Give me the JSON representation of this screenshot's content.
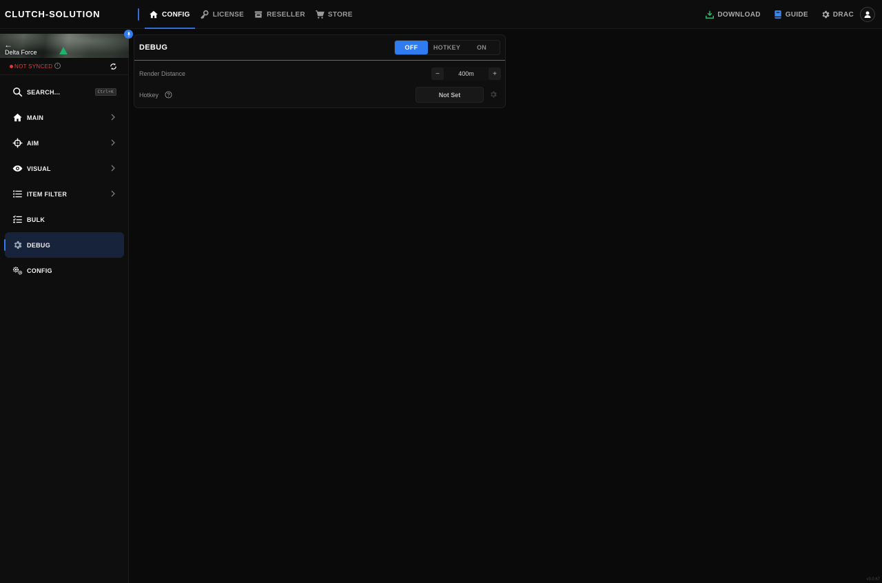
{
  "app": {
    "brand": "CLUTCH-SOLUTION",
    "version": "v3.0.67"
  },
  "topnav": [
    {
      "label": "CONFIG",
      "icon": "home-icon",
      "active": true
    },
    {
      "label": "LICENSE",
      "icon": "key-icon",
      "active": false
    },
    {
      "label": "RESELLER",
      "icon": "store-icon",
      "active": false
    },
    {
      "label": "STORE",
      "icon": "cart-icon",
      "active": false
    }
  ],
  "topright": {
    "download": "DOWNLOAD",
    "guide": "GUIDE",
    "user": "DRAC"
  },
  "sidebar": {
    "game": "Delta Force",
    "sync_status": "NOT SYNCED",
    "search_label": "SEARCH...",
    "search_shortcut": "Ctrl+K",
    "items": [
      {
        "label": "MAIN",
        "icon": "home-icon",
        "has_chevron": true
      },
      {
        "label": "AIM",
        "icon": "crosshair-icon",
        "has_chevron": true
      },
      {
        "label": "VISUAL",
        "icon": "eye-icon",
        "has_chevron": true
      },
      {
        "label": "ITEM FILTER",
        "icon": "list-icon",
        "has_chevron": true
      },
      {
        "label": "BULK",
        "icon": "checklist-icon",
        "has_chevron": false
      },
      {
        "label": "DEBUG",
        "icon": "gear-icon",
        "has_chevron": false,
        "active": true
      },
      {
        "label": "CONFIG",
        "icon": "gears-icon",
        "has_chevron": false
      }
    ]
  },
  "panel": {
    "title": "DEBUG",
    "mode_options": [
      "OFF",
      "HOTKEY",
      "ON"
    ],
    "mode_selected": "OFF",
    "render_distance": {
      "label": "Render Distance",
      "value": "400m",
      "minus": "−",
      "plus": "+"
    },
    "hotkey": {
      "label": "Hotkey",
      "value": "Not Set"
    }
  },
  "colors": {
    "accent": "#2f7bf0",
    "danger": "#e03a3a",
    "download": "#2fb36a"
  }
}
